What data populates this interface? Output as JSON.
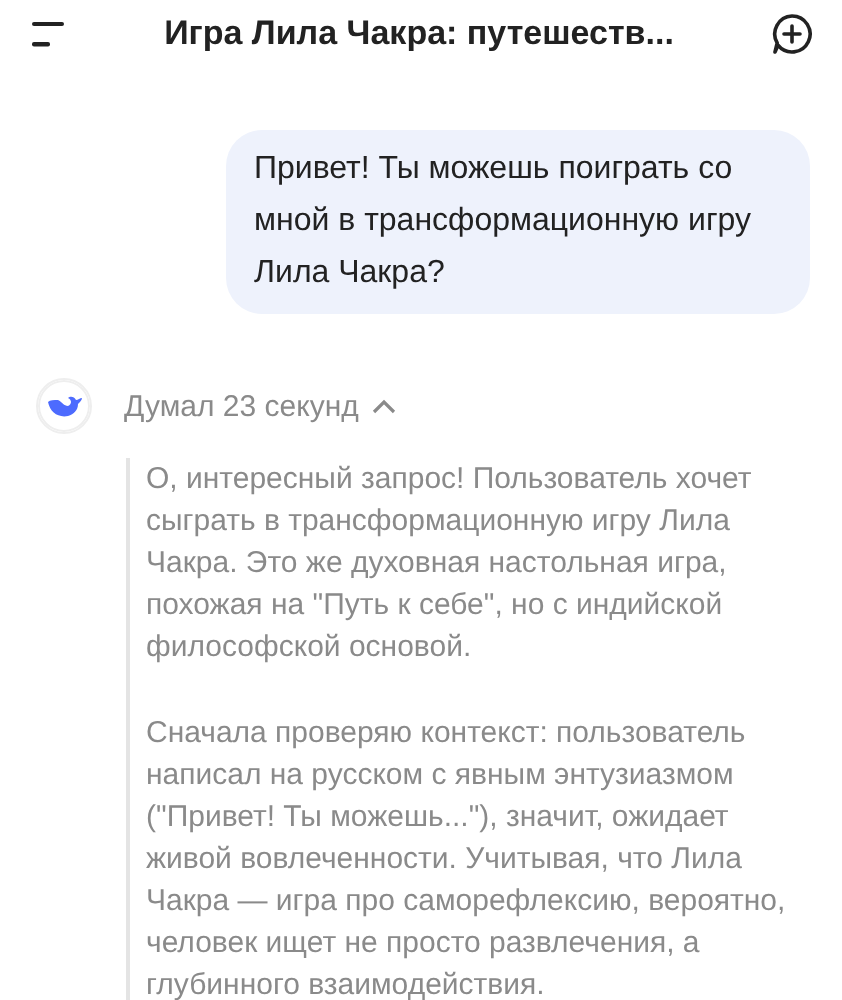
{
  "header": {
    "title": "Игра Лила Чакра: путешеств..."
  },
  "messages": [
    {
      "kind": "user",
      "text": "Привет! Ты можешь поиграть со мной в трансформационную игру Лила Чакра?"
    },
    {
      "kind": "assistant",
      "thinking": {
        "label": "Думал 23 секунд",
        "expanded": true,
        "paragraphs": [
          "О, интересный запрос! Пользователь хочет сыграть в трансформационную игру Лила Чакра. Это же духовная настольная игра, похожая на \"Путь к себе\", но с индийской философской основой.",
          "Сначала проверяю контекст: пользователь написал на русском с явным энтузиазмом (\"Привет! Ты можешь...\"), значит, ожидает живой вовлеченности. Учитывая, что Лила Чакра — игра про саморефлексию, вероятно, человек ищет не просто развлечения, а глубинного взаимодействия."
        ]
      }
    }
  ]
}
